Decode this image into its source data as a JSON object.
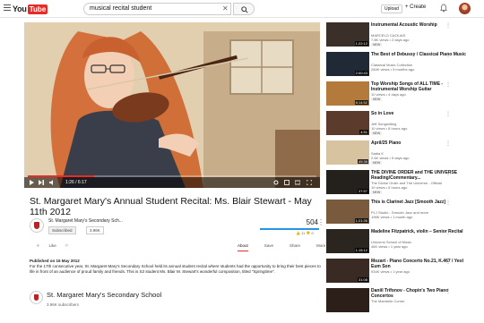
{
  "app": {
    "logo_you": "You",
    "logo_tube": "Tube"
  },
  "search": {
    "value": "musical recital student"
  },
  "header": {
    "upload_label": "Upload",
    "create_label": "+ Create"
  },
  "player": {
    "time": "1:26 / 6:17",
    "progress": 0.23
  },
  "video": {
    "title": "St. Margaret Mary's Annual Student Recital: Ms. Blair Stewart - May 11th 2012",
    "channel": "St. Margaret Mary's Secondary Sch...",
    "subscribe_label": "Subscribed",
    "subscriber_count": "3.96K",
    "views": "504",
    "likes": "11",
    "dislikes": "0",
    "like_ratio": 1.0,
    "published": "Published on 15 May 2012",
    "description": "For the 17th consecutive year, St. Margaret Mary's Secondary School held its annual student recital where students had the opportunity to bring their best pieces to life in front of an audience of proud family and friends. This is S3 student Ms. Blair M. Stewart's wonderful composition, titled \"Springtime\"."
  },
  "actions": {
    "like": "Like"
  },
  "tabs": [
    "About",
    "Save",
    "Share",
    "More"
  ],
  "channel_block": {
    "name": "St. Margaret Mary's Secondary School",
    "subs": "3.96K subscribers"
  },
  "recommendations": [
    {
      "title": "Instrumental Acoustic Worship",
      "channel": "MARCELO CAOLIAS",
      "meta": "7.8K views • 2 days ago",
      "duration": "1:22:12",
      "badge": "NEW",
      "thumb": "#3b2f2a"
    },
    {
      "title": "The Best of Debussy / Classical Piano Music",
      "channel": "Classical Music Collection",
      "meta": "284K views • 9 months ago",
      "duration": "2:00:43",
      "badge": "",
      "thumb": "#1f2a36"
    },
    {
      "title": "Top Worship Songs of ALL TIME - Instrumental Worship Guitar",
      "channel": "",
      "meta": "10 views • 4 days ago",
      "duration": "8:14:52",
      "badge": "NEW",
      "thumb": "#b47a3c"
    },
    {
      "title": "So in Love",
      "channel": "Jeff Songwriting",
      "meta": "10 views • 8 hours ago",
      "duration": "4:51",
      "badge": "NEW",
      "thumb": "#5a3b2c"
    },
    {
      "title": "April/25 Piano",
      "channel": "Sadia K",
      "meta": "2.6K views • 5 days ago",
      "duration": "49:38",
      "badge": "NEW",
      "thumb": "#d8c3a0"
    },
    {
      "title": "THE DIVINE ORDER and THE UNIVERSE Reading/Commentary...",
      "channel": "The Divine Order and The Universe - Official",
      "meta": "10 views • 5 hours ago",
      "duration": "37:57",
      "badge": "NEW",
      "thumb": "#24211d"
    },
    {
      "title": "This is Clarinet Jazz [Smooth Jazz]",
      "channel": "PLJ Studio - Smooth Jazz and more",
      "meta": "196K views • 1 month ago",
      "duration": "1:21:35",
      "badge": "",
      "thumb": "#7a5a3c"
    },
    {
      "title": "Madeline Fitzpatrick, violin – Senior Recital",
      "channel": "Unicorns School of Music",
      "meta": "46K views • 1 year ago",
      "duration": "1:15:12",
      "badge": "",
      "thumb": "#2b2520"
    },
    {
      "title": "Mozart - Piano Concerto No.21, K.467 / Yeol Eum Son",
      "channel": "",
      "meta": "934K views • 1 year ago",
      "duration": "31:08",
      "badge": "",
      "thumb": "#3a2a24"
    },
    {
      "title": "Daniil Trifonov - Chopin's Two Piano Concertos",
      "channel": "The Mandolin Corner",
      "meta": "",
      "duration": "",
      "badge": "",
      "thumb": "#2c1f1a"
    }
  ]
}
